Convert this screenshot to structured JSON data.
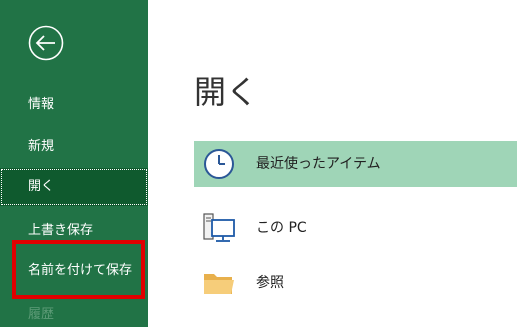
{
  "sidebar": {
    "back_icon": "back-arrow-circle-icon",
    "items": [
      {
        "label": "情報"
      },
      {
        "label": "新規"
      },
      {
        "label": "開く"
      },
      {
        "label": "上書き保存"
      },
      {
        "label": "名前を付けて保存"
      },
      {
        "label": "履歴"
      }
    ]
  },
  "main": {
    "title": "開く",
    "locations": [
      {
        "label": "最近使ったアイテム",
        "icon": "clock-icon"
      },
      {
        "label": "この PC",
        "icon": "computer-icon"
      },
      {
        "label": "参照",
        "icon": "folder-icon"
      }
    ]
  },
  "colors": {
    "sidebar": "#217346",
    "sidebar_selected": "#0f5a2e",
    "selected_location": "#9fd5b7",
    "annotation_box": "#e00000"
  }
}
